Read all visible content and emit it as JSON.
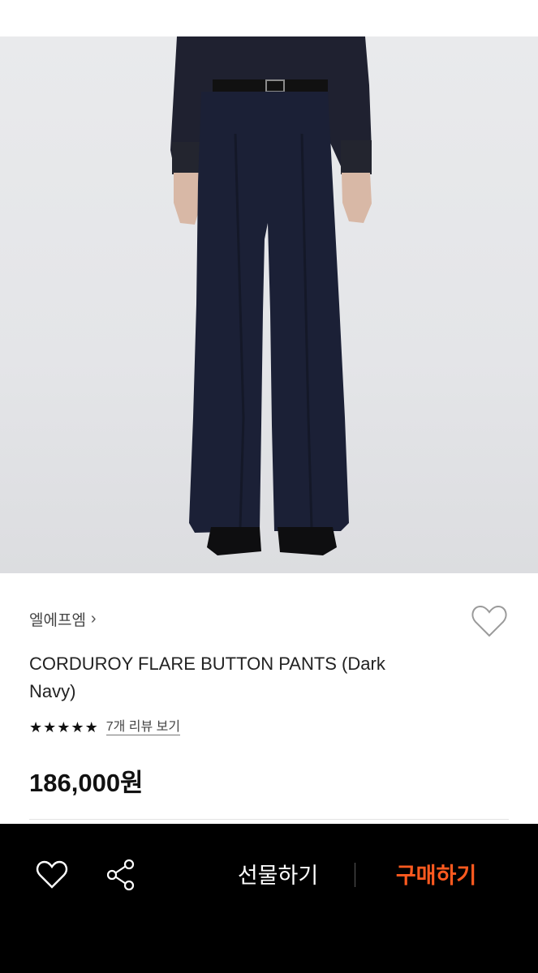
{
  "product": {
    "brand": "엘에프엠",
    "brand_chevron": "›",
    "title": "CORDUROY FLARE BUTTON PANTS (Dark Navy)",
    "rating_stars": 5,
    "review_link": "7개 리뷰 보기",
    "price": "186,000원"
  },
  "icons": {
    "wishlist": "heart-outline-icon",
    "star": "star-icon",
    "share": "share-icon"
  },
  "bottom_bar": {
    "gift_label": "선물하기",
    "buy_label": "구매하기"
  },
  "colors": {
    "bottom_bar_bg": "#000000",
    "buy_accent": "#ff5a1f",
    "pants": "#1b2036"
  }
}
